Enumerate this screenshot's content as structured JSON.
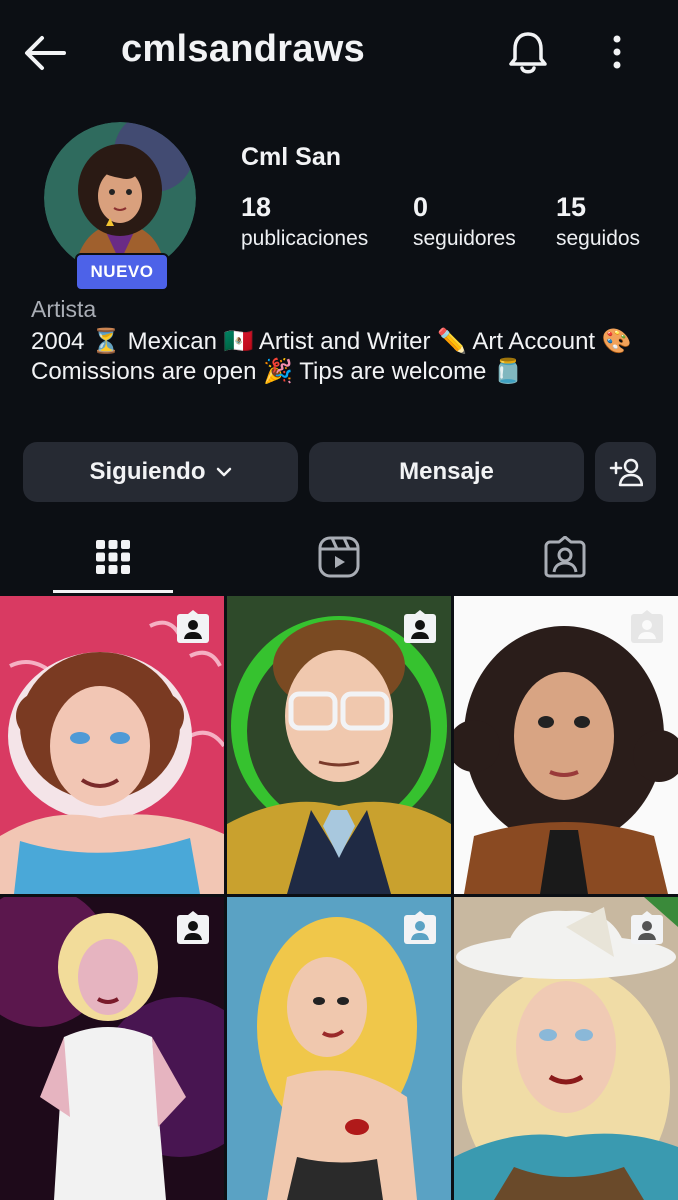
{
  "header": {
    "username": "cmlsandraws",
    "back_icon": "arrow-left-icon",
    "bell_icon": "bell-icon",
    "more_icon": "more-vertical-icon"
  },
  "profile": {
    "display_name": "Cml San",
    "badge": "NUEVO",
    "stats": [
      {
        "value": "18",
        "label": "publicaciones"
      },
      {
        "value": "0",
        "label": "seguidores"
      },
      {
        "value": "15",
        "label": "seguidos"
      }
    ],
    "category": "Artista",
    "bio": "2004 ⏳ Mexican 🇲🇽  Artist and Writer ✏️ Art Account 🎨 Comissions are open 🎉 Tips are welcome 🫙"
  },
  "actions": {
    "following_label": "Siguiendo",
    "message_label": "Mensaje",
    "add_user_icon": "add-user-icon"
  },
  "tabs": [
    {
      "name": "posts-grid",
      "icon": "grid-icon",
      "active": true
    },
    {
      "name": "reels",
      "icon": "reels-icon",
      "active": false
    },
    {
      "name": "tagged",
      "icon": "tagged-icon",
      "active": false
    }
  ],
  "colors": {
    "background": "#0c0f14",
    "button": "#262a33",
    "badge": "#4d62e8",
    "muted_text": "#a9adb5"
  },
  "grid_posts": [
    {
      "subject": "curly-haired woman, pink background",
      "tagged": true
    },
    {
      "subject": "man with glasses, green background",
      "tagged": true
    },
    {
      "subject": "dark curly-haired woman, white background",
      "tagged": true
    },
    {
      "subject": "blonde woman in white fringe dress",
      "tagged": true
    },
    {
      "subject": "blonde woman looking over shoulder",
      "tagged": true
    },
    {
      "subject": "blonde woman in white hat",
      "tagged": true
    }
  ]
}
